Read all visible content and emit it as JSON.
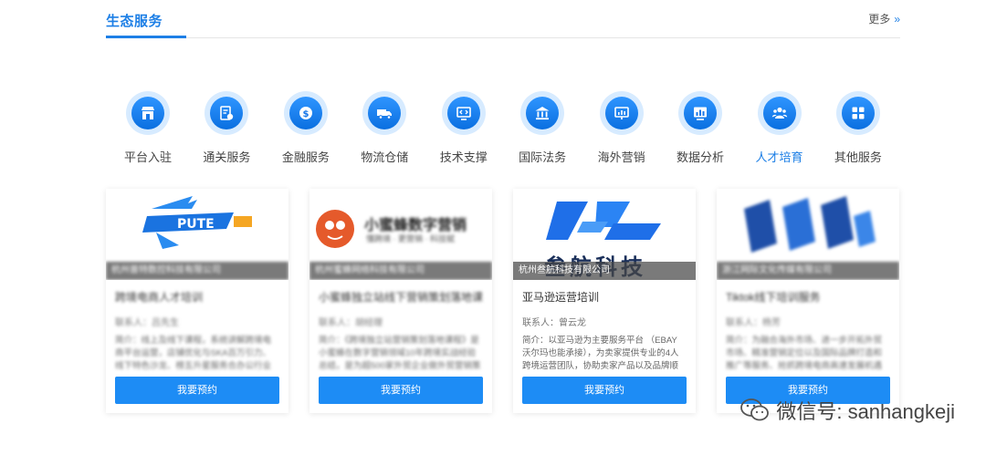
{
  "header": {
    "title": "生态服务",
    "more_label": "更多",
    "more_icon": "double-chevron-right-icon",
    "accent": "#1d7fe6"
  },
  "categories": [
    {
      "label": "平台入驻",
      "icon": "storefront-icon"
    },
    {
      "label": "通关服务",
      "icon": "customs-document-icon"
    },
    {
      "label": "金融服务",
      "icon": "finance-icon"
    },
    {
      "label": "物流仓储",
      "icon": "truck-icon"
    },
    {
      "label": "技术支撑",
      "icon": "code-monitor-icon"
    },
    {
      "label": "国际法务",
      "icon": "courthouse-icon"
    },
    {
      "label": "海外营销",
      "icon": "marketing-board-icon"
    },
    {
      "label": "数据分析",
      "icon": "chart-monitor-icon"
    },
    {
      "label": "人才培育",
      "icon": "people-icon",
      "active": true
    },
    {
      "label": "其他服务",
      "icon": "grid-icon"
    }
  ],
  "cards": [
    {
      "logo_text": "PUTE",
      "company": "杭州普特数控科技有限公司",
      "title": "跨境电商人才培训",
      "contact": "联系人：吕先生",
      "desc": "简介：线上及线下课程，系统讲解跨境电商平台运营，店铺优化与SKA百万引力、线下特色沙龙、榜五升星服务合办公行业沙龙品质提升、陪访诊断规划…",
      "button": "我要预约",
      "blurred": true
    },
    {
      "logo_text": "小蜜蜂数字营销",
      "logo_sub": "懂跨境 · 更营销 · 科技赋",
      "company": "杭州蜜蜂网络科技有限公司",
      "title": "小蜜蜂独立站线下营销策划落地课",
      "contact": "联系人：胡经理",
      "desc": "简介：《跨境独立站营销策划落地课程》是小蜜蜂在数字营销领域10年跨境实战经验总结，是为超500家外贸企业做外贸营销策划的一套方法…",
      "button": "我要预约",
      "blurred": true
    },
    {
      "logo_text": "叁航科技",
      "company": "杭州叁航科技有限公司",
      "title": "亚马逊运营培训",
      "contact": "联系人：曾云龙",
      "desc": "简介：以亚马逊为主要服务平台 （EBAY 沃尔玛也能承接），为卖家提供专业的4人跨境运营团队，协助卖家产品以及品牌顺利出海。",
      "button": "我要预约",
      "blurred": false
    },
    {
      "logo_text": "",
      "company": "浙江网际文化传媒有限公司",
      "title": "Tiktok线下培训服务",
      "contact": "联系人：杨芳",
      "desc": "简介：为融合海外市场、进一步开拓外贸市场、精准营销定位以及国际品牌打造和推广等服务、抢抓跨境电商高速发展机遇期，为企业大力培…",
      "button": "我要预约",
      "blurred": true
    }
  ],
  "watermark": {
    "text": "微信号: sanhangkeji",
    "icon": "wechat-icon"
  }
}
